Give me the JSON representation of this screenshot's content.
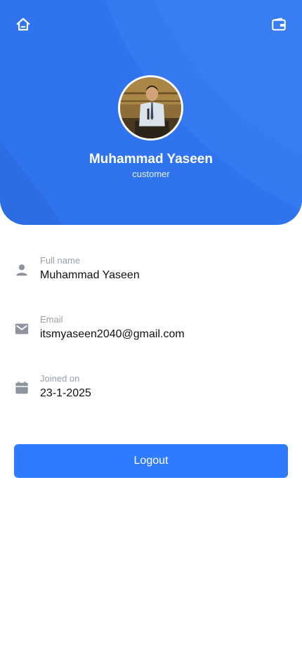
{
  "header": {
    "home_icon": "home-icon",
    "wallet_icon": "wallet-icon",
    "background_color": "#2f74ee"
  },
  "profile": {
    "name": "Muhammad Yaseen",
    "role": "customer"
  },
  "details": [
    {
      "icon": "person-icon",
      "label": "Full name",
      "value": "Muhammad Yaseen"
    },
    {
      "icon": "mail-icon",
      "label": "Email",
      "value": "itsmyaseen2040@gmail.com"
    },
    {
      "icon": "calendar-icon",
      "label": "Joined on",
      "value": "23-1-2025"
    }
  ],
  "actions": {
    "logout_label": "Logout",
    "accent_color": "#2f7bff"
  }
}
